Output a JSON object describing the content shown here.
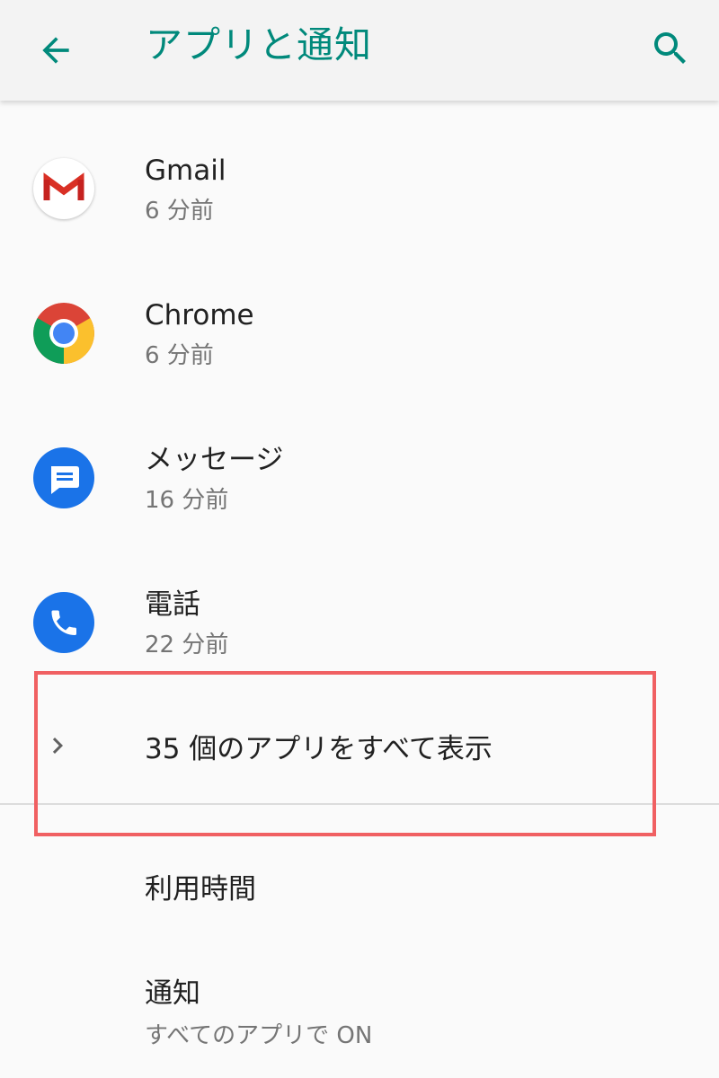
{
  "header": {
    "title": "アプリと通知"
  },
  "recent_apps": [
    {
      "name": "Gmail",
      "time": "6 分前",
      "icon": "gmail-icon"
    },
    {
      "name": "Chrome",
      "time": "6 分前",
      "icon": "chrome-icon"
    },
    {
      "name": "メッセージ",
      "time": "16 分前",
      "icon": "messages-icon"
    },
    {
      "name": "電話",
      "time": "22 分前",
      "icon": "phone-icon"
    }
  ],
  "see_all": {
    "label": "35 個のアプリをすべて表示",
    "icon": "chevron-right-icon"
  },
  "settings": [
    {
      "label": "利用時間"
    },
    {
      "label": "通知",
      "summary": "すべてのアプリで ON"
    }
  ],
  "colors": {
    "accent": "#00897b",
    "highlight": "#f06062",
    "appbar_bg": "#f3f3f3",
    "background": "#fafafa"
  }
}
